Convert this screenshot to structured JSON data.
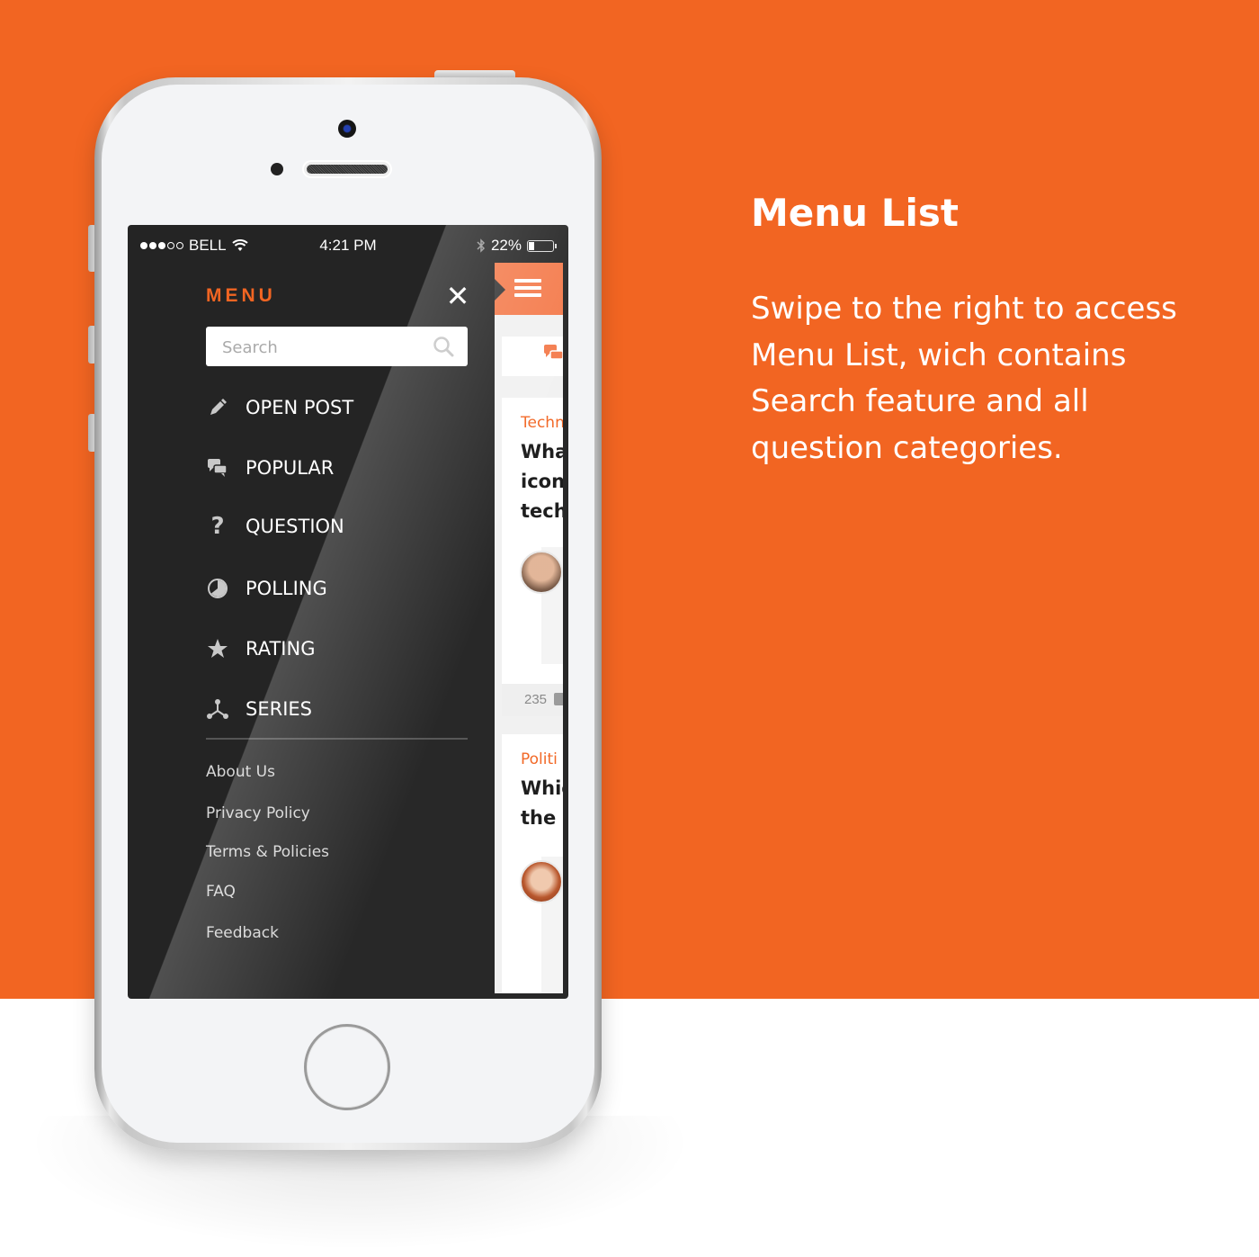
{
  "theme": {
    "accent": "#f26522",
    "menu_bg": "#242424",
    "header_orange": "#f47b4c"
  },
  "status_bar": {
    "carrier": "BELL",
    "signal_bars_filled": 3,
    "signal_bars_total": 5,
    "time": "4:21 PM",
    "battery": "22%",
    "battery_level": 0.22
  },
  "menu": {
    "title": "MENU",
    "close_icon": "close-icon",
    "search": {
      "placeholder": "Search",
      "value": "",
      "icon": "search-icon"
    },
    "items": [
      {
        "label": "OPEN POST",
        "icon": "pencil-icon"
      },
      {
        "label": "POPULAR",
        "icon": "chat-bubbles-icon"
      },
      {
        "label": "QUESTION",
        "icon": "question-mark-icon"
      },
      {
        "label": "POLLING",
        "icon": "pie-chart-icon"
      },
      {
        "label": "RATING",
        "icon": "star-icon"
      },
      {
        "label": "SERIES",
        "icon": "network-icon"
      }
    ],
    "footer_links": [
      {
        "label": "About Us"
      },
      {
        "label": "Privacy Policy"
      },
      {
        "label": "Terms & Policies"
      },
      {
        "label": "FAQ"
      },
      {
        "label": "Feedback"
      }
    ]
  },
  "feed_peek": {
    "menu_icon": "hamburger-icon",
    "tab_icon": "chat-bubbles-icon",
    "cards": [
      {
        "category": "Techn",
        "question_lines": [
          "Wha",
          "icon",
          "tech"
        ],
        "avatar": "male-avatar"
      },
      {
        "category": "Politi",
        "question_lines": [
          "Whic",
          "the r"
        ],
        "avatar": "female-avatar"
      }
    ],
    "comment_count": "235"
  },
  "promo": {
    "heading": "Menu List",
    "description": "Swipe to the right to access Menu List, wich contains Search feature and all question categories."
  }
}
